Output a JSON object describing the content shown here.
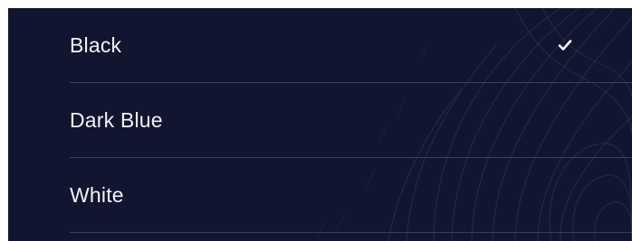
{
  "options": [
    {
      "label": "Black",
      "selected": true
    },
    {
      "label": "Dark Blue",
      "selected": false
    },
    {
      "label": "White",
      "selected": false
    }
  ],
  "colors": {
    "background": "#121530",
    "text": "#f2f3f8",
    "divider": "#3b3f5f",
    "check": "#ffffff"
  },
  "icons": {
    "selected": "checkmark-icon",
    "background": "contour-pattern"
  }
}
